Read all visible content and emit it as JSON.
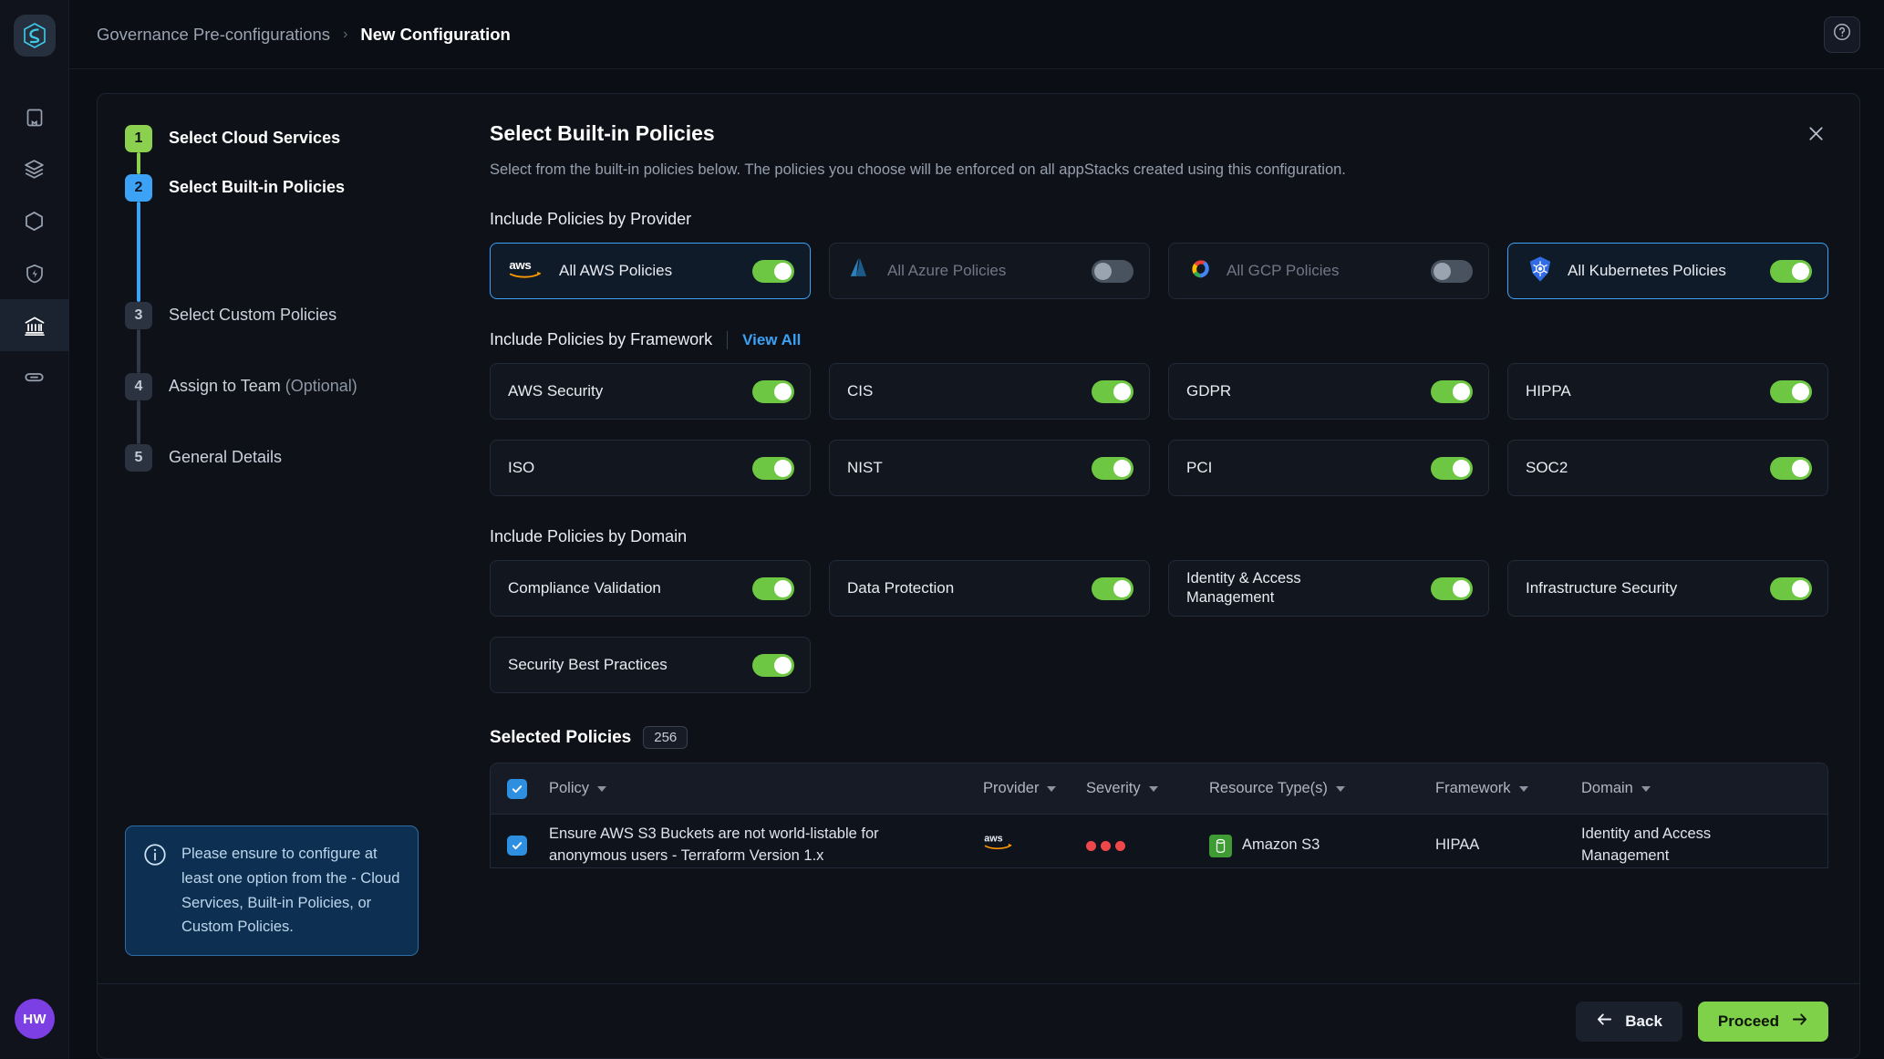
{
  "rail": {
    "logo": "app-logo",
    "items": [
      {
        "name": "book-icon",
        "label": "Docs"
      },
      {
        "name": "layers-icon",
        "label": "Stacks"
      },
      {
        "name": "hexagon-icon",
        "label": "Modules"
      },
      {
        "name": "shield-bolt-icon",
        "label": "Security"
      },
      {
        "name": "bank-icon",
        "label": "Governance",
        "active": true
      },
      {
        "name": "link-icon",
        "label": "Integrations"
      }
    ],
    "avatar_initials": "HW"
  },
  "topbar": {
    "breadcrumb_parent": "Governance Pre-configurations",
    "breadcrumb_separator": "›",
    "breadcrumb_current": "New Configuration",
    "help_label": "Help"
  },
  "stepper": {
    "steps": [
      {
        "num": "1",
        "label": "Select Cloud Services",
        "state": "done",
        "optional": ""
      },
      {
        "num": "2",
        "label": "Select Built-in Policies",
        "state": "active",
        "optional": ""
      },
      {
        "num": "3",
        "label": "Select Custom Policies",
        "state": "todo",
        "optional": ""
      },
      {
        "num": "4",
        "label": "Assign to Team",
        "state": "todo",
        "optional": "(Optional)"
      },
      {
        "num": "5",
        "label": "General Details",
        "state": "todo",
        "optional": ""
      }
    ],
    "info_text": "Please ensure to configure at least one option from the - Cloud Services, Built-in Policies, or Custom Policies."
  },
  "panel": {
    "title": "Select Built-in Policies",
    "subtitle": "Select from the built-in policies below. The policies you choose will be enforced on all appStacks created using this configuration.",
    "close_label": "Close",
    "provider_section_title": "Include Policies by Provider",
    "framework_section_title": "Include Policies by Framework",
    "framework_view_all": "View All",
    "domain_section_title": "Include Policies by Domain",
    "providers": [
      {
        "label": "All AWS Policies",
        "icon": "aws-logo-icon",
        "on": true,
        "selected": true,
        "disabled": false
      },
      {
        "label": "All Azure Policies",
        "icon": "azure-logo-icon",
        "on": false,
        "selected": false,
        "disabled": true
      },
      {
        "label": "All GCP Policies",
        "icon": "gcp-logo-icon",
        "on": false,
        "selected": false,
        "disabled": true
      },
      {
        "label": "All Kubernetes Policies",
        "icon": "kubernetes-logo-icon",
        "on": true,
        "selected": true,
        "disabled": false
      }
    ],
    "frameworks": [
      {
        "label": "AWS Security",
        "on": true
      },
      {
        "label": "CIS",
        "on": true
      },
      {
        "label": "GDPR",
        "on": true
      },
      {
        "label": "HIPPA",
        "on": true
      },
      {
        "label": "ISO",
        "on": true
      },
      {
        "label": "NIST",
        "on": true
      },
      {
        "label": "PCI",
        "on": true
      },
      {
        "label": "SOC2",
        "on": true
      }
    ],
    "domains": [
      {
        "label": "Compliance Validation",
        "on": true
      },
      {
        "label": "Data Protection",
        "on": true
      },
      {
        "label": "Identity & Access Management",
        "on": true
      },
      {
        "label": "Infrastructure Security",
        "on": true
      },
      {
        "label": "Security Best Practices",
        "on": true
      }
    ]
  },
  "selected_policies": {
    "title": "Selected Policies",
    "count": "256",
    "columns": [
      "Policy",
      "Provider",
      "Severity",
      "Resource Type(s)",
      "Framework",
      "Domain"
    ],
    "rows": [
      {
        "checked": true,
        "policy": "Ensure AWS S3 Buckets are not world-listable for anonymous users - Terraform Version 1.x",
        "provider": "aws",
        "severity_dots": 3,
        "resource_type": "Amazon S3",
        "framework": "HIPAA",
        "domain": "Identity and Access Management"
      }
    ]
  },
  "footer": {
    "back_label": "Back",
    "proceed_label": "Proceed"
  },
  "colors": {
    "accent_blue": "#3ba2f5",
    "accent_green": "#7ed148",
    "toggle_on": "#6dc743",
    "toggle_off": "#49525f",
    "severity_red": "#f0474a",
    "bg": "#0b0e14"
  }
}
